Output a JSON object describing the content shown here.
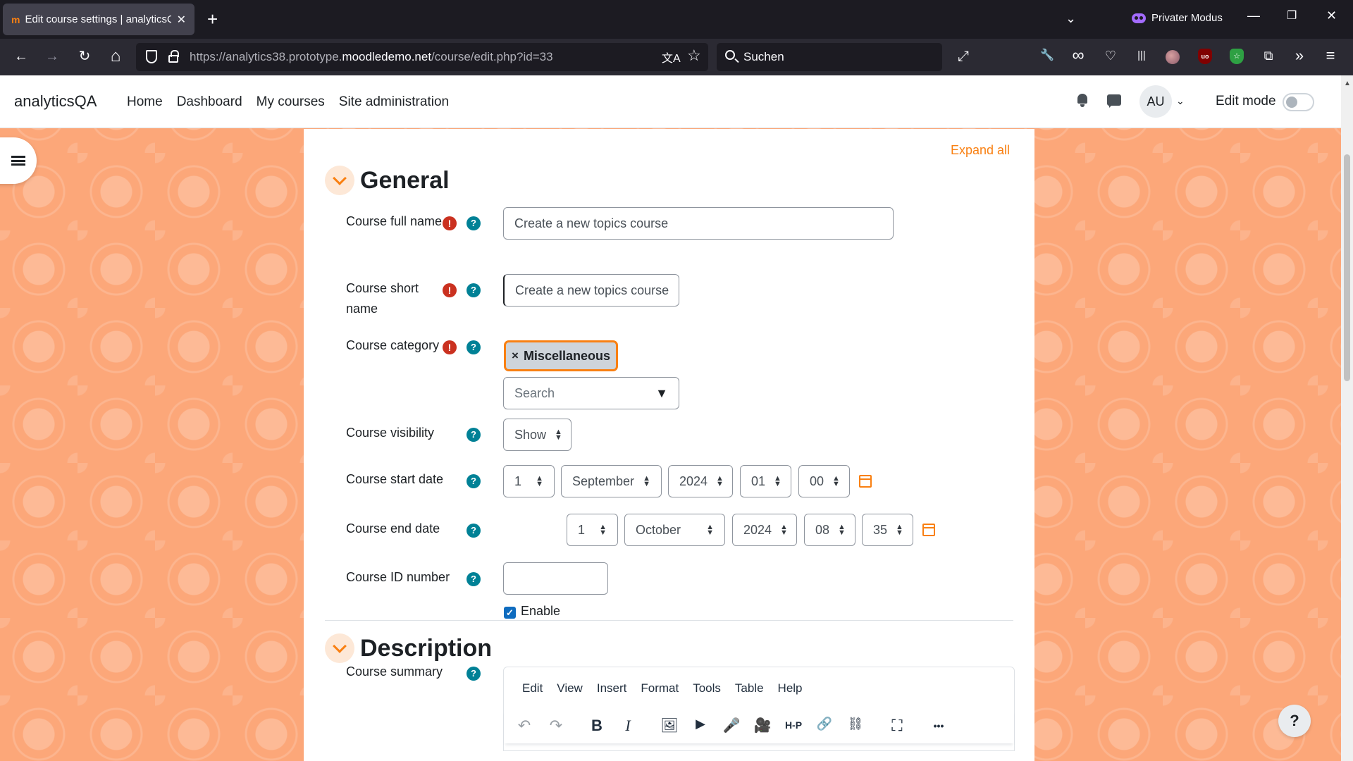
{
  "browser": {
    "tab_title": "Edit course settings | analyticsQA",
    "tab_favicon": "m",
    "new_tab": "+",
    "private_label": "Privater Modus",
    "url_prefix": "https://analytics38.prototype.",
    "url_host": "moodledemo.net",
    "url_path": "/course/edit.php?id=33",
    "search_placeholder": "Suchen",
    "ublock_label": "uo",
    "icons": {
      "translate": "文A",
      "star": "☆",
      "back": "←",
      "forward": "→",
      "reload": "↻",
      "home": "⌂",
      "fullscreen": "⤢",
      "wrench": "🔧",
      "mask": "∞",
      "pocket": "♡",
      "library": "|||",
      "extensions": "⧉",
      "overflow": "»",
      "menu": "≡",
      "minimize": "—",
      "restore": "❐",
      "close": "✕",
      "tab_list": "⌄",
      "tab_close": "✕"
    }
  },
  "site": {
    "brand": "analyticsQA",
    "nav": [
      "Home",
      "Dashboard",
      "My courses",
      "Site administration"
    ],
    "user_initials": "AU",
    "user_caret": "⌄",
    "edit_mode_label": "Edit mode"
  },
  "form": {
    "expand_all": "Expand all",
    "general_title": "General",
    "description_title": "Description",
    "required_glyph": "!",
    "help_glyph": "?",
    "fields": {
      "full_name_label": "Course full name",
      "full_name_value": "Create a new topics course",
      "short_name_label": "Course short name",
      "short_name_value": "Create a new topics course",
      "category_label": "Course category",
      "category_chip": "Miscellaneous",
      "chip_remove": "×",
      "category_search_placeholder": "Search",
      "category_dropdown": "▼",
      "visibility_label": "Course visibility",
      "visibility_value": "Show",
      "start_date_label": "Course start date",
      "start_day": "1",
      "start_month": "September",
      "start_year": "2024",
      "start_hour": "01",
      "start_minute": "00",
      "end_date_label": "Course end date",
      "end_enable_label": "Enable",
      "end_enable_check": "✓",
      "end_day": "1",
      "end_month": "October",
      "end_year": "2024",
      "end_hour": "08",
      "end_minute": "35",
      "id_number_label": "Course ID number",
      "id_number_value": "",
      "summary_label": "Course summary"
    },
    "editor": {
      "menu": [
        "Edit",
        "View",
        "Insert",
        "Format",
        "Tools",
        "Table",
        "Help"
      ],
      "toolbar": {
        "undo": "↶",
        "redo": "↷",
        "bold": "B",
        "italic": "I",
        "image": "🖼",
        "media": "▶",
        "record_audio": "🎤",
        "record_video": "🎥",
        "h5p": "H-P",
        "link": "🔗",
        "unlink": "⛓",
        "fullscreen": "⛶",
        "more": "•••"
      }
    }
  },
  "help_fab": "?",
  "scroll_up": "▲",
  "select_arrows": {
    "up": "▲",
    "down": "▼"
  }
}
